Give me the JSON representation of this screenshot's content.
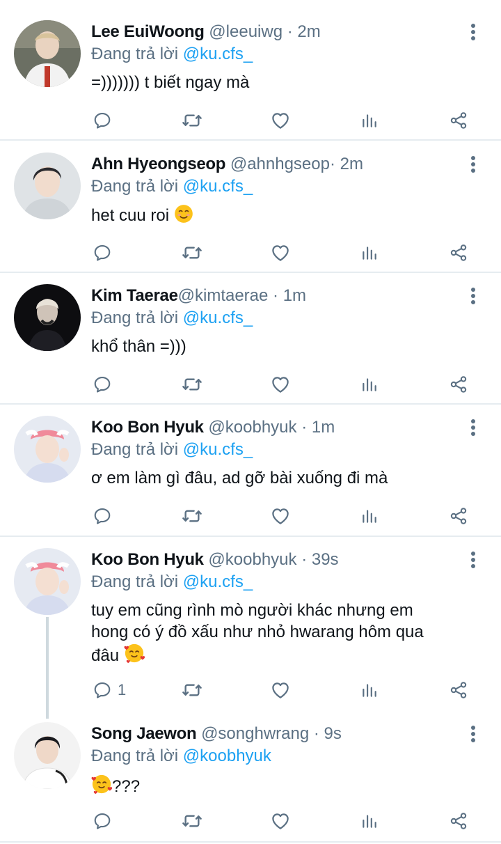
{
  "reply_prefix": "Đang trả lời",
  "tweets": [
    {
      "name": "Lee EuiWoong",
      "handle": "@leeuiwg",
      "time": "· 2m",
      "reply_to": "@ku.cfs_",
      "text": "=))))))) t biết ngay mà",
      "reply_count": ""
    },
    {
      "name": "Ahn Hyeongseop",
      "handle": "@ahnhgseop",
      "time": "· 2m",
      "reply_to": "@ku.cfs_",
      "text": "het cuu roi",
      "emoji": "smiling-face",
      "reply_count": ""
    },
    {
      "name": "Kim Taerae",
      "handle": "@kimtaerae",
      "time": "· 1m",
      "reply_to": "@ku.cfs_",
      "text": "khổ thân =)))",
      "reply_count": ""
    },
    {
      "name": "Koo Bon Hyuk",
      "handle": "@koobhyuk",
      "time": "· 1m",
      "reply_to": "@ku.cfs_",
      "text": "ơ em làm gì đâu, ad gỡ bài xuống đi mà",
      "reply_count": ""
    },
    {
      "name": "Koo Bon Hyuk",
      "handle": "@koobhyuk",
      "time": "· 39s",
      "reply_to": "@ku.cfs_",
      "text_line1": "tuy em cũng rình mò người khác nhưng em",
      "text_line2": "hong có ý đồ xấu như nhỏ hwarang hôm qua",
      "text_line3": "đâu",
      "emoji": "smiling-face-with-hearts",
      "reply_count": "1"
    },
    {
      "name": "Song Jaewon",
      "handle": "@songhwrang",
      "time": "· 9s",
      "reply_to": "@koobhyuk",
      "text": "???",
      "emoji": "smiling-face-with-hearts",
      "reply_count": ""
    }
  ],
  "colors": {
    "link": "#1da1f2",
    "muted": "#5b7083",
    "text": "#0f1419",
    "divider": "#e6ecf0"
  },
  "icons": [
    "reply-icon",
    "retweet-icon",
    "like-icon",
    "analytics-icon",
    "share-icon",
    "more-options-icon"
  ]
}
